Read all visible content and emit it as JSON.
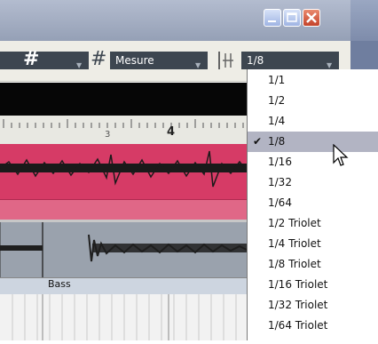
{
  "toolbar": {
    "snap_type_value": "Mesure",
    "quantize_value": "1/8"
  },
  "ruler": {
    "bar3": "3",
    "bar4": "4"
  },
  "tracks": [
    {
      "name": ""
    },
    {
      "name": "Bass"
    }
  ],
  "quantize_menu": {
    "selected": "1/8",
    "items": [
      "1/1",
      "1/2",
      "1/4",
      "1/8",
      "1/16",
      "1/32",
      "1/64",
      "1/2 Triolet",
      "1/4 Triolet",
      "1/8 Triolet",
      "1/16 Triolet",
      "1/32 Triolet",
      "1/64 Triolet"
    ]
  },
  "colors": {
    "track1": "#d63b66",
    "track2": "#9aa2ad",
    "menu_highlight": "#b2b4c3",
    "close_button": "#c4432a"
  }
}
